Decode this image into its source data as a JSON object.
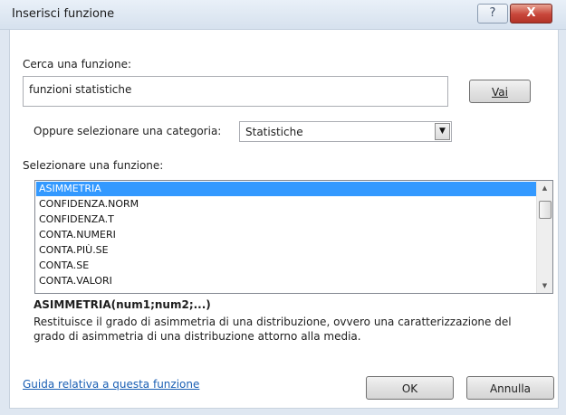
{
  "window": {
    "title": "Inserisci funzione",
    "help_glyph": "?",
    "close_glyph": "X"
  },
  "search": {
    "label": "Cerca una funzione:",
    "value": "funzioni statistiche",
    "go_label": "Vai"
  },
  "category": {
    "label": "Oppure selezionare una categoria:",
    "selected": "Statistiche"
  },
  "functions": {
    "label": "Selezionare una funzione:",
    "items": [
      "ASIMMETRIA",
      "CONFIDENZA.NORM",
      "CONFIDENZA.T",
      "CONTA.NUMERI",
      "CONTA.PIÙ.SE",
      "CONTA.SE",
      "CONTA.VALORI"
    ],
    "selected_index": 0
  },
  "details": {
    "syntax": "ASIMMETRIA(num1;num2;...)",
    "description": "Restituisce il grado di asimmetria di una distribuzione, ovvero una caratterizzazione del grado di asimmetria di una distribuzione attorno alla media."
  },
  "footer": {
    "help_link": "Guida relativa a questa funzione",
    "ok_label": "OK",
    "cancel_label": "Annulla"
  },
  "colors": {
    "selection": "#3399ff",
    "link": "#1a5fb4",
    "close": "#c8463a"
  },
  "icons": {
    "dropdown": "chevron-down-icon",
    "scroll_up": "arrow-up-icon",
    "scroll_down": "arrow-down-icon"
  }
}
